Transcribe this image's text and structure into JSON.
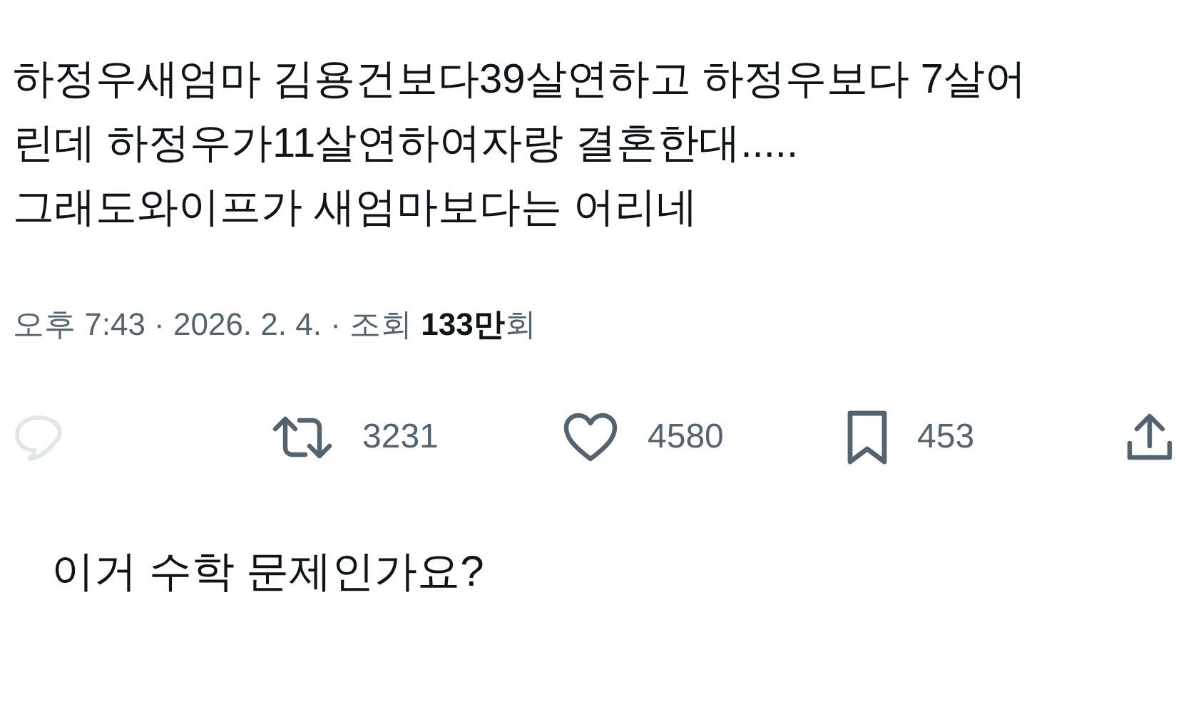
{
  "post": {
    "text_lines": [
      "하정우새엄마 김용건보다39살연하고 하정우보다 7살어",
      "린데 하정우가11살연하여자랑 결혼한대.....",
      "그래도와이프가 새엄마보다는 어리네"
    ],
    "meta": "오후 7:43 · 2026. 2. 4. · 조회 **133만**회",
    "actions": [
      {
        "kind": "reply"
      },
      {
        "kind": "repost",
        "count": "3231"
      },
      {
        "kind": "like",
        "count": "4580"
      },
      {
        "kind": "bookmark",
        "count": "453"
      },
      {
        "kind": "share"
      }
    ]
  },
  "caption": "이거 수학 문제인가요?"
}
